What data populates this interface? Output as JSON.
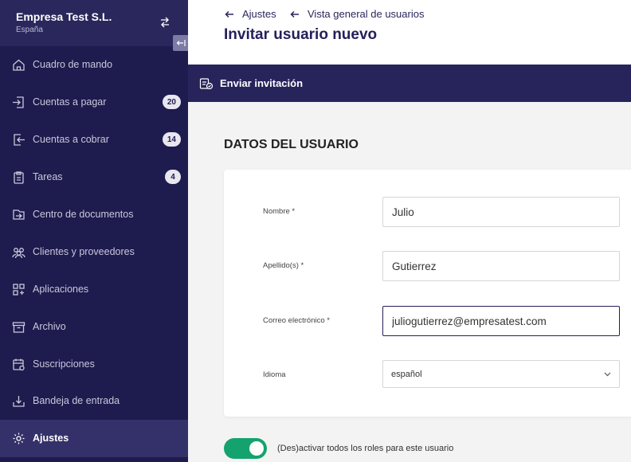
{
  "sidebar": {
    "company": "Empresa Test S.L.",
    "country": "España",
    "items": [
      {
        "label": "Cuadro de mando",
        "icon": "home-icon"
      },
      {
        "label": "Cuentas a pagar",
        "icon": "incoming-icon",
        "badge": "20"
      },
      {
        "label": "Cuentas a cobrar",
        "icon": "outgoing-icon",
        "badge": "14"
      },
      {
        "label": "Tareas",
        "icon": "clipboard-icon",
        "badge": "4"
      },
      {
        "label": "Centro de documentos",
        "icon": "documents-icon"
      },
      {
        "label": "Clientes y proveedores",
        "icon": "people-icon"
      },
      {
        "label": "Aplicaciones",
        "icon": "apps-icon"
      },
      {
        "label": "Archivo",
        "icon": "archive-icon"
      },
      {
        "label": "Suscripciones",
        "icon": "calendar-icon"
      },
      {
        "label": "Bandeja de entrada",
        "icon": "inbox-icon"
      },
      {
        "label": "Ajustes",
        "icon": "gear-icon",
        "active": true
      }
    ]
  },
  "breadcrumbs": [
    "Ajustes",
    "Vista general de usuarios"
  ],
  "page_title": "Invitar usuario nuevo",
  "action_bar": {
    "send_label": "Enviar invitación"
  },
  "section_title": "DATOS DEL USUARIO",
  "form": {
    "name": {
      "label": "Nombre *",
      "value": "Julio"
    },
    "surname": {
      "label": "Apellido(s) *",
      "value": "Gutierrez"
    },
    "email": {
      "label": "Correo electrónico *",
      "value": "juliogutierrez@empresatest.com"
    },
    "language": {
      "label": "Idioma",
      "value": "español"
    }
  },
  "toggle": {
    "label": "(Des)activar todos los roles para este usuario",
    "on": true
  },
  "colors": {
    "sidebar_bg": "#1e1b4e",
    "accent": "#27245b",
    "toggle_on": "#14a36e"
  }
}
